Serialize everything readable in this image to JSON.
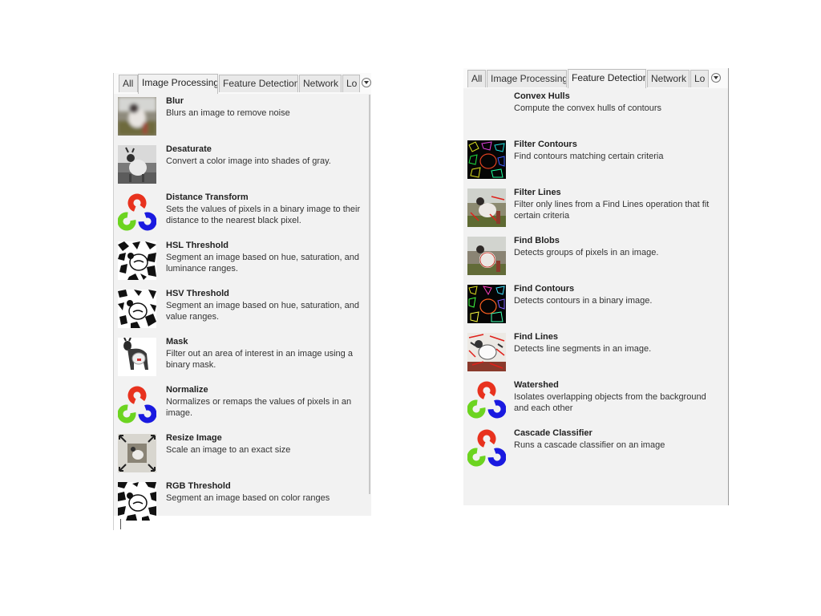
{
  "left_panel": {
    "tabs": [
      "All",
      "Image Processing",
      "Feature Detection",
      "Network",
      "Lo"
    ],
    "active_tab": "Image Processing",
    "operations": [
      {
        "name": "Blur",
        "description": "Blurs an image to remove noise",
        "icon": "blur-thumbnail-icon"
      },
      {
        "name": "Desaturate",
        "description": "Convert a color image into shades of gray.",
        "icon": "desaturate-thumbnail-icon"
      },
      {
        "name": "Distance Transform",
        "description": "Sets the values of pixels in a binary image to their distance to the nearest black pixel.",
        "icon": "opencv-logo-icon"
      },
      {
        "name": "HSL Threshold",
        "description": "Segment an image based on hue, saturation, and luminance ranges.",
        "icon": "threshold-thumbnail-icon"
      },
      {
        "name": "HSV Threshold",
        "description": "Segment an image based on hue, saturation, and value ranges.",
        "icon": "threshold-thumbnail-icon"
      },
      {
        "name": "Mask",
        "description": "Filter out an area of interest in an image using a binary mask.",
        "icon": "mask-thumbnail-icon"
      },
      {
        "name": "Normalize",
        "description": "Normalizes or remaps the values of pixels in an image.",
        "icon": "opencv-logo-icon"
      },
      {
        "name": "Resize Image",
        "description": "Scale an image to an exact size",
        "icon": "resize-thumbnail-icon"
      },
      {
        "name": "RGB Threshold",
        "description": "Segment an image based on color ranges",
        "icon": "threshold-thumbnail-icon"
      }
    ]
  },
  "right_panel": {
    "tabs": [
      "All",
      "Image Processing",
      "Feature Detection",
      "Network",
      "Lo"
    ],
    "active_tab": "Feature Detection",
    "operations": [
      {
        "name": "Convex Hulls",
        "description": "Compute the convex hulls of contours",
        "icon": "none"
      },
      {
        "name": "Filter Contours",
        "description": "Find contours matching certain criteria",
        "icon": "contours-thumbnail-icon"
      },
      {
        "name": "Filter Lines",
        "description": "Filter only lines from a Find Lines operation that fit certain criteria",
        "icon": "lines-thumbnail-icon"
      },
      {
        "name": "Find Blobs",
        "description": "Detects groups of pixels in an image.",
        "icon": "blobs-thumbnail-icon"
      },
      {
        "name": "Find Contours",
        "description": "Detects contours in a binary image.",
        "icon": "contours-thumbnail-icon"
      },
      {
        "name": "Find Lines",
        "description": "Detects line segments in an image.",
        "icon": "lines-thumbnail-icon"
      },
      {
        "name": "Watershed",
        "description": "Isolates overlapping objects from the background and each other",
        "icon": "opencv-logo-icon"
      },
      {
        "name": "Cascade Classifier",
        "description": "Runs a cascade classifier on an image",
        "icon": "opencv-logo-icon"
      }
    ]
  }
}
